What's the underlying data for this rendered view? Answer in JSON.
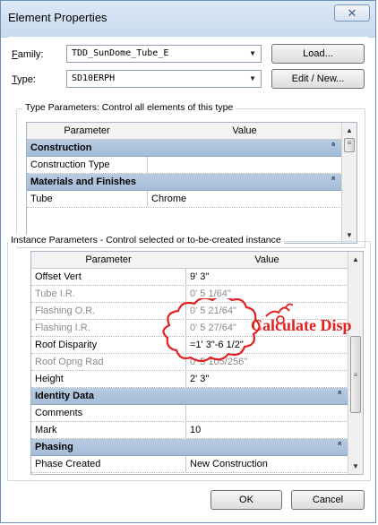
{
  "window": {
    "title": "Element Properties",
    "close_glyph": "⌧"
  },
  "family": {
    "label_prefix": "",
    "label_key": "F",
    "label_rest": "amily:",
    "value": "TDD_SunDome_Tube_E",
    "load_label": "Load..."
  },
  "type": {
    "label_key": "T",
    "label_rest": "ype:",
    "value": "SD10ERPH",
    "edit_label": "Edit / New..."
  },
  "type_params": {
    "group_title": "Type Parameters: Control all elements of this type",
    "col_parameter": "Parameter",
    "col_value": "Value",
    "rows": [
      {
        "kind": "section",
        "name": "Construction"
      },
      {
        "kind": "param",
        "name": "Construction Type",
        "value": ""
      },
      {
        "kind": "section",
        "name": "Materials and Finishes"
      },
      {
        "kind": "param",
        "name": "Tube",
        "value": "Chrome"
      }
    ]
  },
  "instance_params": {
    "group_title": "Instance Parameters - Control selected or to-be-created instance",
    "col_parameter": "Parameter",
    "col_value": "Value",
    "rows": [
      {
        "kind": "param",
        "name": "Offset Vert",
        "value": "9'  3\"",
        "readonly": false
      },
      {
        "kind": "param",
        "name": "Tube I.R.",
        "value": "0'  5 1/64\"",
        "readonly": true
      },
      {
        "kind": "param",
        "name": "Flashing O.R.",
        "value": "0'  5 21/64\"",
        "readonly": true
      },
      {
        "kind": "param",
        "name": "Flashing I.R.",
        "value": "0'  5 27/64\"",
        "readonly": true
      },
      {
        "kind": "param",
        "name": "Roof Disparity",
        "value": "=1'  3\"-6 1/2\"",
        "readonly": false
      },
      {
        "kind": "param",
        "name": "Roof Opng Rad",
        "value": "0'  5 105/256\"",
        "readonly": true
      },
      {
        "kind": "param",
        "name": "Height",
        "value": "2'  3\"",
        "readonly": false
      },
      {
        "kind": "section",
        "name": "Identity Data"
      },
      {
        "kind": "param",
        "name": "Comments",
        "value": "",
        "readonly": false
      },
      {
        "kind": "param",
        "name": "Mark",
        "value": "10",
        "readonly": false
      },
      {
        "kind": "section",
        "name": "Phasing"
      },
      {
        "kind": "param",
        "name": "Phase Created",
        "value": "New Construction",
        "readonly": false
      }
    ]
  },
  "annotation": {
    "text": "Calculate Disp",
    "color": "#e32020"
  },
  "buttons": {
    "ok": "OK",
    "cancel": "Cancel"
  },
  "icons": {
    "dropdown": "triangle-down",
    "collapse": "double-chevron-up",
    "scroll_up": "triangle-up",
    "scroll_down": "triangle-down",
    "close": "x"
  }
}
